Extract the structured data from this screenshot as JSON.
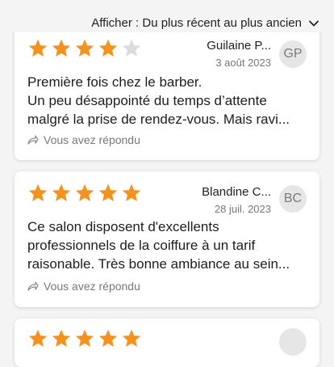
{
  "sort": {
    "label": "Afficher : Du plus récent au plus ancien",
    "icon": "chevron-down-icon"
  },
  "colors": {
    "star_filled": "#f5921e",
    "star_empty": "#dcdcdc",
    "avatar_bg": "#e6e6e6"
  },
  "reviews": [
    {
      "rating": 4,
      "author": "Guilaine P...",
      "date": "3 août 2023",
      "initials": "GP",
      "lines": [
        "Première fois chez le barber.",
        "Un peu désappointé du temps d’attente",
        "malgré la prise de rendez-vous. Mais ravi..."
      ],
      "reply_label": "Vous avez répondu"
    },
    {
      "rating": 5,
      "author": "Blandine C...",
      "date": "28 juil. 2023",
      "initials": "BC",
      "lines": [
        "Ce salon disposent d'excellents",
        "professionnels de la coiffure à un tarif",
        "raisonable. Très bonne ambiance au sein..."
      ],
      "reply_label": "Vous avez répondu"
    },
    {
      "rating": 5,
      "author": "",
      "date": "",
      "initials": "",
      "lines": [],
      "reply_label": ""
    }
  ]
}
